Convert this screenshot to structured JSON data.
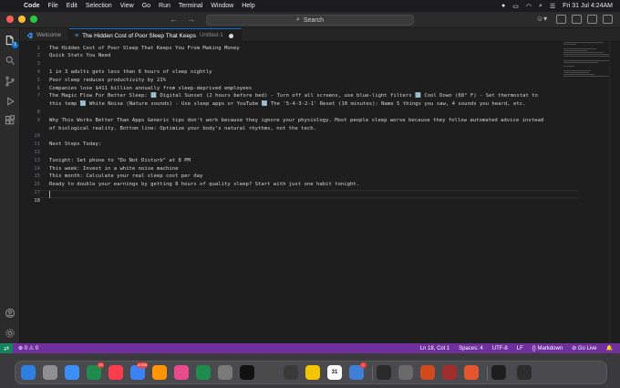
{
  "menubar": {
    "app": "Code",
    "items": [
      "File",
      "Edit",
      "Selection",
      "View",
      "Go",
      "Run",
      "Terminal",
      "Window",
      "Help"
    ],
    "clock": "Fri 31 Jul  4:24AM"
  },
  "titlebar": {
    "search_label": "Search"
  },
  "activity": {
    "explorer_badge": "1"
  },
  "tabs": [
    {
      "label": "Welcome"
    },
    {
      "label": "The Hidden Cost of Poor Sleep That Keeps",
      "sub": "Untitled-1"
    }
  ],
  "editor": {
    "line_numbers": [
      "1",
      "2",
      "3",
      "4",
      "5",
      "6",
      "7",
      "",
      "8",
      "9",
      "",
      "10",
      "11",
      "12",
      "13",
      "14",
      "15",
      "16",
      "17",
      "18"
    ],
    "lines": [
      "The Hidden Cost of Poor Sleep That Keeps You From Making Money",
      "Quick Stats You Need",
      "",
      "1 in 3 adults gets less than 6 hours of sleep nightly",
      "Poor sleep reduces productivity by 21%",
      "Companies lose $411 billion annually from sleep-deprived employees",
      "The Magic Flow For Better Sleep: 🔢 Digital Sunset (2 hours before bed) - Turn off all screens, use blue-light filters 🔢 Cool Down (68° F) - Set thermostat to",
      "this temp 🔢 White Noise (Nature sounds) - Use sleep apps or YouTube 🔢 The '5-4-3-2-1' Reset (10 minutes): Name 5 things you saw, 4 sounds you heard, etc.",
      "",
      "Why This Works Better Than Apps Generic tips don't work because they ignore your physiology. Most people sleep worse because they follow automated advice instead",
      "of biological reality. Bottom line: Optimize your body's natural rhythms, not the tech.",
      "",
      "Next Steps Today:",
      "",
      "Tonight: Set phone to \"Do Not Disturb\" at 8 PM",
      "This week: Invest in a white noise machine",
      "This month: Calculate your real sleep cost per day",
      "Ready to double your earnings by getting 8 hours of quality sleep? Start with just one habit tonight.",
      "",
      ""
    ],
    "current_line": "18"
  },
  "statusbar": {
    "problems": "⊗ 0 ⚠ 0",
    "position": "Ln 18, Col 1",
    "spaces": "Spaces: 4",
    "encoding": "UTF-8",
    "eol": "LF",
    "language": "{} Markdown",
    "golive": "⊘ Go Live"
  },
  "dock": {
    "badges": {
      "messages": "33",
      "mail": "4,685",
      "prefs": "1"
    },
    "calendar_day": "31",
    "colors": [
      "#2f7fe0",
      "#8e8e93",
      "#3a8ef6",
      "#1f8b4c",
      "#fa3c4c",
      "#3b82f6",
      "#ff9500",
      "#e94b8c",
      "#1f8b4c",
      "#7a7a7a",
      "#111111",
      "#4a4a4a",
      "#3a3a3a",
      "#f5c400",
      "#0f5c8a",
      "#3f7fd6",
      "#2a2a2a",
      "#6a6a6a",
      "#d04a1e",
      "#a12d2d",
      "#e4572e",
      "#1e1e1e",
      "#2c2c2c",
      "#fb542b",
      "#0a74d9",
      "#f0f0f0",
      "#5a5a5a",
      "#3a3a3a",
      "#2a2a2a",
      "#5a5a5a"
    ]
  }
}
